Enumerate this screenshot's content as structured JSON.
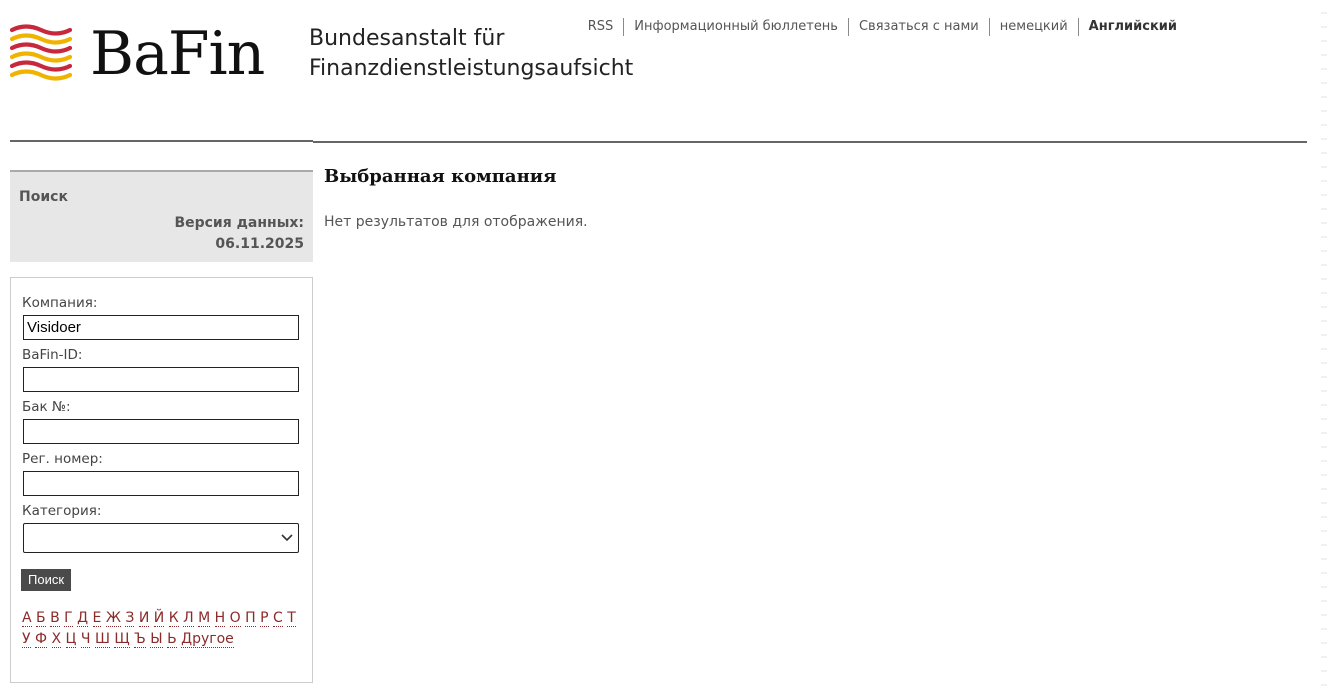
{
  "logo": {
    "word": "BaFin",
    "agency_line1": "Bundesanstalt für",
    "agency_line2": "Finanzdienstleistungsaufsicht"
  },
  "topnav": [
    "RSS",
    "Информационный бюллетень",
    "Связаться с нами",
    "немецкий",
    "Английский"
  ],
  "sidebar": {
    "title": "Поиск",
    "version_label": "Версия данных:",
    "version_date": "06.11.2025"
  },
  "form": {
    "company_label": "Компания:",
    "company_value": "Visidoer",
    "bafin_id_label": "BaFin-ID:",
    "bafin_id_value": "",
    "bak_label": "Бак №:",
    "bak_value": "",
    "reg_label": "Рег. номер:",
    "reg_value": "",
    "category_label": "Категория:",
    "category_value": "",
    "search_button": "Поиск"
  },
  "alphabet": [
    "А",
    "Б",
    "В",
    "Г",
    "Д",
    "Е",
    "Ж",
    "З",
    "И",
    "Й",
    "К",
    "Л",
    "М",
    "Н",
    "О",
    "П",
    "Р",
    "С",
    "Т",
    "У",
    "Ф",
    "Х",
    "Ц",
    "Ч",
    "Ш",
    "Щ",
    "Ъ",
    "Ы",
    "Ь",
    "Другое"
  ],
  "main": {
    "title": "Выбранная компания",
    "message": "Нет результатов для отображения."
  },
  "colors": {
    "link": "#8b2a2a",
    "logo_red": "#c8283c",
    "logo_yellow": "#f0b400"
  }
}
